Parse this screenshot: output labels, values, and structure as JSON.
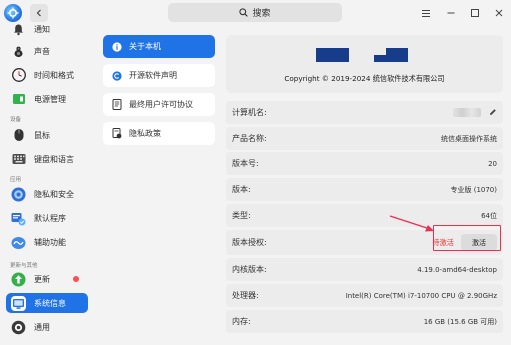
{
  "titlebar": {
    "search_placeholder": "搜索"
  },
  "sidebar": {
    "items": [
      {
        "id": "notify",
        "label": "通知",
        "icon": "bell-icon",
        "color": "#3a3a3a"
      },
      {
        "id": "sound",
        "label": "声音",
        "icon": "speaker-icon",
        "color": "#3a3a3a"
      },
      {
        "id": "time",
        "label": "时间和格式",
        "icon": "clock-icon",
        "color": "#f0f0f0"
      },
      {
        "id": "power",
        "label": "电源管理",
        "icon": "battery-icon",
        "color": "#2fb34a"
      },
      {
        "id": "mouse",
        "label": "鼠标",
        "icon": "mouse-icon",
        "color": "#3a3a3a"
      },
      {
        "id": "keyboard",
        "label": "键盘和语言",
        "icon": "keyboard-icon",
        "color": "#4d4d4d"
      },
      {
        "id": "privacy",
        "label": "隐私和安全",
        "icon": "shield-icon",
        "color": "#2f6fd6"
      },
      {
        "id": "defaults",
        "label": "默认程序",
        "icon": "default-apps-icon",
        "color": "#2f6fd6"
      },
      {
        "id": "assist",
        "label": "辅助功能",
        "icon": "accessibility-icon",
        "color": "#3f8ae8"
      },
      {
        "id": "update",
        "label": "更新",
        "icon": "update-arrow-icon",
        "color": "#34b04a"
      },
      {
        "id": "sysinfo",
        "label": "系统信息",
        "icon": "system-info-icon",
        "color": "#ffffff"
      },
      {
        "id": "general",
        "label": "通用",
        "icon": "general-settings-icon",
        "color": "#3a3a3a"
      }
    ],
    "sections": {
      "device": "设备",
      "app": "应用",
      "update_other": "更新与其他"
    }
  },
  "submenu": {
    "items": [
      {
        "label": "关于本机",
        "icon": "info-icon"
      },
      {
        "label": "开源软件声明",
        "icon": "copyright-icon"
      },
      {
        "label": "最终用户许可协议",
        "icon": "document-icon"
      },
      {
        "label": "隐私政策",
        "icon": "privacy-doc-icon"
      }
    ]
  },
  "about": {
    "copyright": "Copyright © 2019-2024 统信软件技术有限公司",
    "computer_name_label": "计算机名:",
    "product_name_label": "产品名称:",
    "product_name": "统信桌面操作系统",
    "version_no_label": "版本号:",
    "version_no": "20",
    "edition_label": "版本:",
    "edition": "专业版 (1070)",
    "type_label": "类型:",
    "type": "64位",
    "license_label": "版本授权:",
    "license_status": "待激活",
    "activate_button": "激活",
    "kernel_label": "内核版本:",
    "kernel": "4.19.0-amd64-desktop",
    "cpu_label": "处理器:",
    "cpu": "Intel(R) Core(TM) i7-10700 CPU @ 2.90GHz",
    "memory_label": "内存:",
    "memory": "16 GB (15.6 GB 可用)"
  },
  "colors": {
    "accent": "#1f73e6",
    "annotation": "#e8304f",
    "pending": "#e53935"
  }
}
